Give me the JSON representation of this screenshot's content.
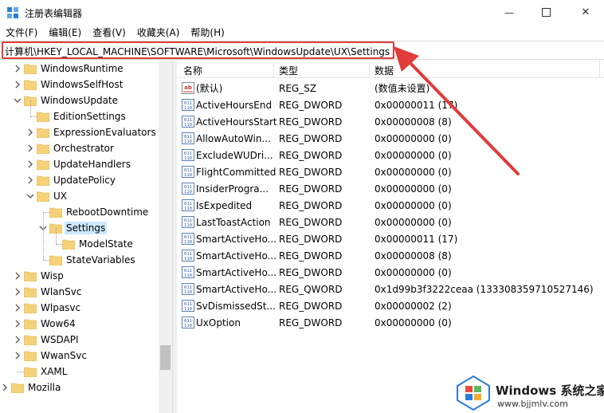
{
  "window": {
    "title": "注册表编辑器",
    "minimize_glyph": "—",
    "close_glyph": "✕"
  },
  "menu": [
    "文件(F)",
    "编辑(E)",
    "查看(V)",
    "收藏夹(A)",
    "帮助(H)"
  ],
  "address": {
    "path": "计算机\\HKEY_LOCAL_MACHINE\\SOFTWARE\\Microsoft\\WindowsUpdate\\UX\\Settings",
    "highlight_color": "#e23b3b"
  },
  "tree": [
    {
      "label": "WindowsRuntime",
      "level": 1,
      "twisty": "collapsed"
    },
    {
      "label": "WindowsSelfHost",
      "level": 1,
      "twisty": "collapsed"
    },
    {
      "label": "WindowsUpdate",
      "level": 1,
      "twisty": "expanded"
    },
    {
      "label": "EditionSettings",
      "level": 2,
      "twisty": "none"
    },
    {
      "label": "ExpressionEvaluators",
      "level": 2,
      "twisty": "collapsed"
    },
    {
      "label": "Orchestrator",
      "level": 2,
      "twisty": "collapsed"
    },
    {
      "label": "UpdateHandlers",
      "level": 2,
      "twisty": "collapsed"
    },
    {
      "label": "UpdatePolicy",
      "level": 2,
      "twisty": "collapsed"
    },
    {
      "label": "UX",
      "level": 2,
      "twisty": "expanded"
    },
    {
      "label": "RebootDowntime",
      "level": 3,
      "twisty": "none"
    },
    {
      "label": "Settings",
      "level": 3,
      "twisty": "expanded",
      "selected": true
    },
    {
      "label": "ModelState",
      "level": 4,
      "twisty": "none"
    },
    {
      "label": "StateVariables",
      "level": 3,
      "twisty": "none"
    },
    {
      "label": "Wisp",
      "level": 1,
      "twisty": "collapsed"
    },
    {
      "label": "WlanSvc",
      "level": 1,
      "twisty": "collapsed"
    },
    {
      "label": "Wlpasvc",
      "level": 1,
      "twisty": "collapsed"
    },
    {
      "label": "Wow64",
      "level": 1,
      "twisty": "collapsed"
    },
    {
      "label": "WSDAPI",
      "level": 1,
      "twisty": "collapsed"
    },
    {
      "label": "WwanSvc",
      "level": 1,
      "twisty": "collapsed"
    },
    {
      "label": "XAML",
      "level": 1,
      "twisty": "none"
    },
    {
      "label": "Mozilla",
      "level": 0,
      "twisty": "collapsed"
    }
  ],
  "list": {
    "columns": [
      "名称",
      "类型",
      "数据"
    ],
    "rows": [
      {
        "name": "(默认)",
        "type": "REG_SZ",
        "data": "(数值未设置)",
        "icon": "string-value-icon"
      },
      {
        "name": "ActiveHoursEnd",
        "type": "REG_DWORD",
        "data": "0x00000011 (17)",
        "icon": "binary-value-icon"
      },
      {
        "name": "ActiveHoursStart",
        "type": "REG_DWORD",
        "data": "0x00000008 (8)",
        "icon": "binary-value-icon"
      },
      {
        "name": "AllowAutoWin...",
        "type": "REG_DWORD",
        "data": "0x00000000 (0)",
        "icon": "binary-value-icon"
      },
      {
        "name": "ExcludeWUDri...",
        "type": "REG_DWORD",
        "data": "0x00000000 (0)",
        "icon": "binary-value-icon"
      },
      {
        "name": "FlightCommitted",
        "type": "REG_DWORD",
        "data": "0x00000000 (0)",
        "icon": "binary-value-icon"
      },
      {
        "name": "InsiderProgra...",
        "type": "REG_DWORD",
        "data": "0x00000000 (0)",
        "icon": "binary-value-icon"
      },
      {
        "name": "IsExpedited",
        "type": "REG_DWORD",
        "data": "0x00000000 (0)",
        "icon": "binary-value-icon"
      },
      {
        "name": "LastToastAction",
        "type": "REG_DWORD",
        "data": "0x00000000 (0)",
        "icon": "binary-value-icon"
      },
      {
        "name": "SmartActiveHo...",
        "type": "REG_DWORD",
        "data": "0x00000011 (17)",
        "icon": "binary-value-icon"
      },
      {
        "name": "SmartActiveHo...",
        "type": "REG_DWORD",
        "data": "0x00000008 (8)",
        "icon": "binary-value-icon"
      },
      {
        "name": "SmartActiveHo...",
        "type": "REG_DWORD",
        "data": "0x00000000 (0)",
        "icon": "binary-value-icon"
      },
      {
        "name": "SmartActiveHo...",
        "type": "REG_QWORD",
        "data": "0x1d99b3f3222ceaa (133308359710527146)",
        "icon": "binary-value-icon"
      },
      {
        "name": "SvDismissedSt...",
        "type": "REG_DWORD",
        "data": "0x00000002 (2)",
        "icon": "binary-value-icon"
      },
      {
        "name": "UxOption",
        "type": "REG_DWORD",
        "data": "0x00000000 (0)",
        "icon": "binary-value-icon"
      }
    ]
  },
  "watermark": {
    "title": "Windows 系统之家",
    "url": "www.bjjmlv.com"
  },
  "colors": {
    "folder": "#f5d27a",
    "selection": "#cce8ff",
    "arrow": "#e23b3b"
  }
}
